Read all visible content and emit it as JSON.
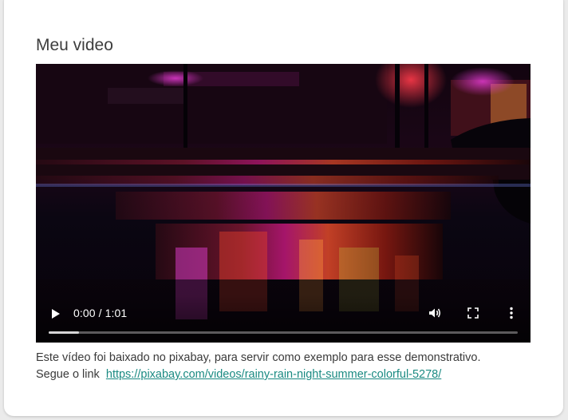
{
  "card": {
    "title": "Meu video"
  },
  "video": {
    "time_display": "0:00 / 1:01",
    "progress_buffered_fraction": 0.065,
    "icons": {
      "play": "play-icon",
      "volume": "volume-icon",
      "fullscreen": "fullscreen-icon",
      "more": "more-options-icon"
    }
  },
  "caption": {
    "line1": "Este vídeo foi baixado no pixabay, para servir como exemplo para esse demonstrativo.",
    "prefix": "Segue o link",
    "link_text": "https://pixabay.com/videos/rainy-rain-night-summer-colorful-5278/"
  },
  "colors": {
    "link": "#1a8a82",
    "title": "#3d3d3d",
    "background": "#ebebeb"
  }
}
